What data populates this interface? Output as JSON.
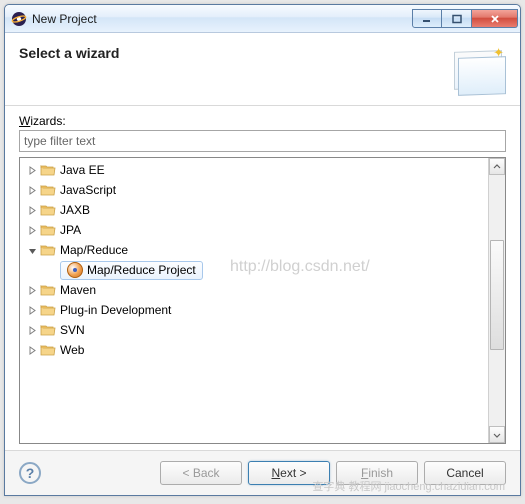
{
  "window": {
    "title": "New Project"
  },
  "header": {
    "title": "Select a wizard"
  },
  "wizards_label_prefix": "W",
  "wizards_label_rest": "izards:",
  "filter_placeholder": "type filter text",
  "tree": [
    {
      "label": "Java EE",
      "expanded": false
    },
    {
      "label": "JavaScript",
      "expanded": false
    },
    {
      "label": "JAXB",
      "expanded": false
    },
    {
      "label": "JPA",
      "expanded": false
    },
    {
      "label": "Map/Reduce",
      "expanded": true,
      "children": [
        {
          "label": "Map/Reduce Project",
          "selected": true
        }
      ]
    },
    {
      "label": "Maven",
      "expanded": false
    },
    {
      "label": "Plug-in Development",
      "expanded": false
    },
    {
      "label": "SVN",
      "expanded": false
    },
    {
      "label": "Web",
      "expanded": false
    }
  ],
  "buttons": {
    "back": "< Back",
    "next_u": "N",
    "next_rest": "ext >",
    "finish_u": "F",
    "finish_rest": "inish",
    "cancel": "Cancel"
  },
  "watermark": "http://blog.csdn.net/",
  "watermark2": "查字典  教程网  jiaocheng.chazidian.com"
}
